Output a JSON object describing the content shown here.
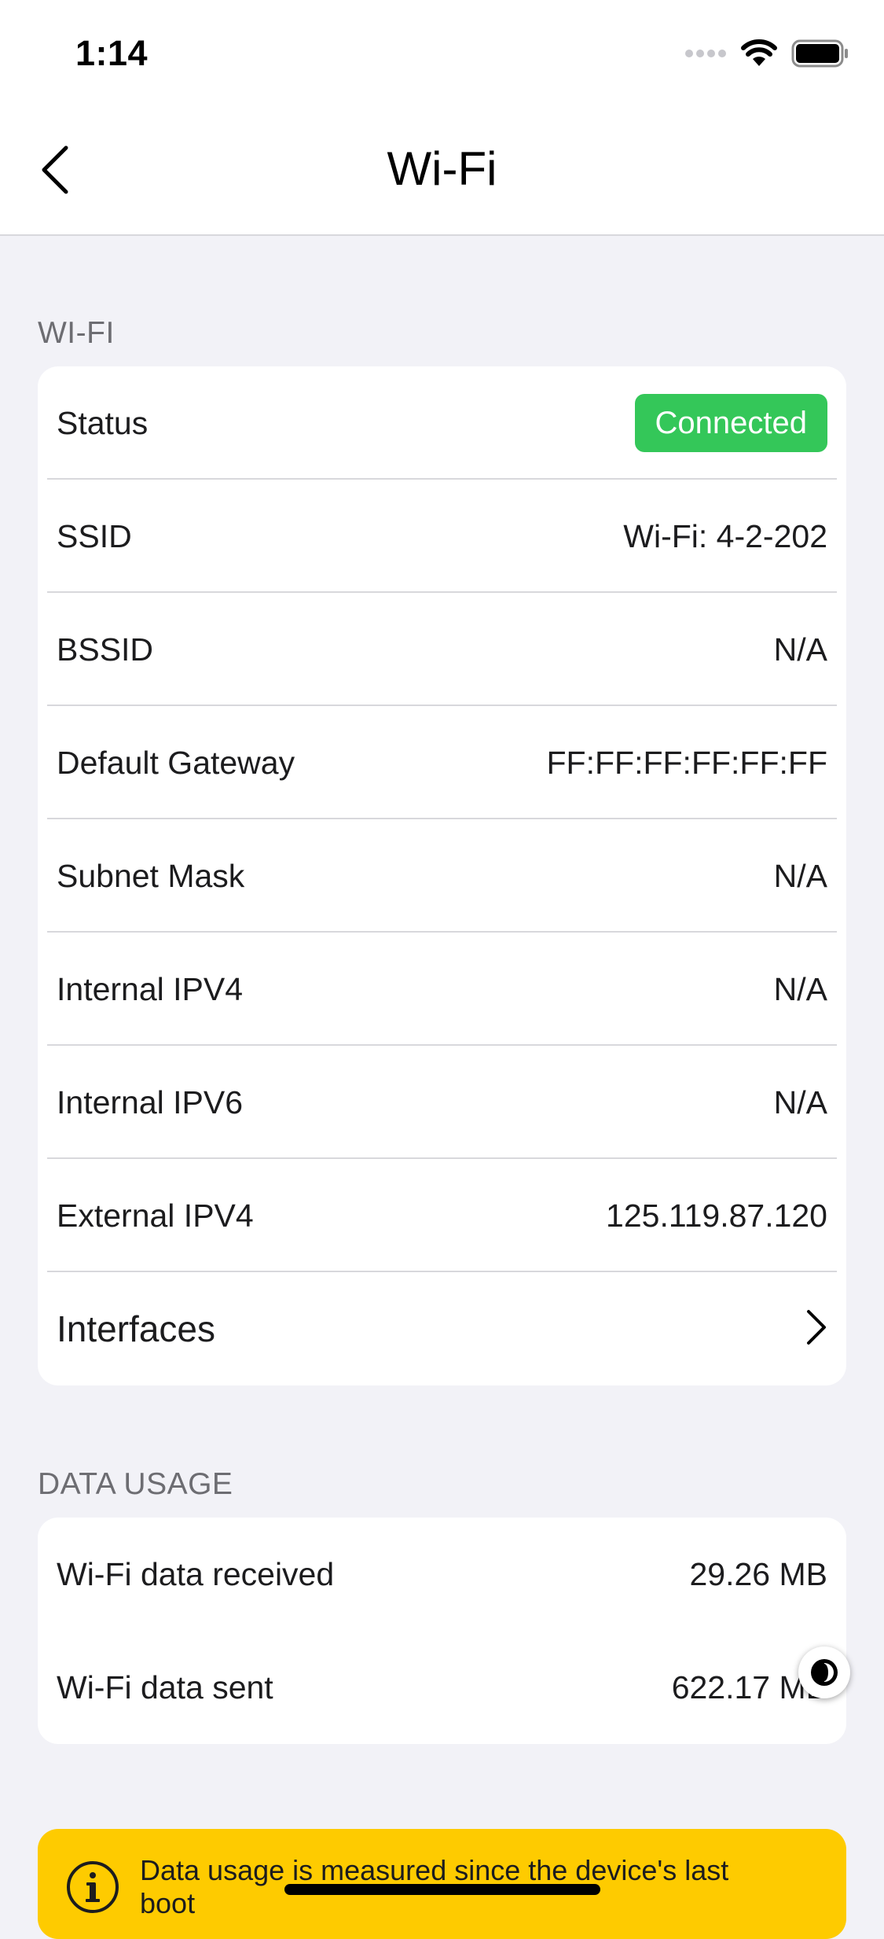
{
  "status_bar": {
    "time": "1:14"
  },
  "nav": {
    "title": "Wi-Fi"
  },
  "wifi_section": {
    "header": "WI-FI",
    "status": {
      "label": "Status",
      "value": "Connected",
      "color": "#34c759"
    },
    "rows": [
      {
        "label": "SSID",
        "value": "Wi-Fi: 4-2-202"
      },
      {
        "label": "BSSID",
        "value": "N/A"
      },
      {
        "label": "Default Gateway",
        "value": "FF:FF:FF:FF:FF:FF"
      },
      {
        "label": "Subnet Mask",
        "value": "N/A"
      },
      {
        "label": "Internal IPV4",
        "value": "N/A"
      },
      {
        "label": "Internal IPV6",
        "value": "N/A"
      },
      {
        "label": "External IPV4",
        "value": "125.119.87.120"
      }
    ],
    "interfaces_label": "Interfaces"
  },
  "data_usage": {
    "header": "DATA USAGE",
    "rows": [
      {
        "label": "Wi-Fi data received",
        "value": "29.26 MB"
      },
      {
        "label": "Wi-Fi data sent",
        "value": "622.17 MB"
      }
    ]
  },
  "notice": {
    "text": "Data usage is measured since the device's last boot",
    "color": "#fecb00"
  }
}
